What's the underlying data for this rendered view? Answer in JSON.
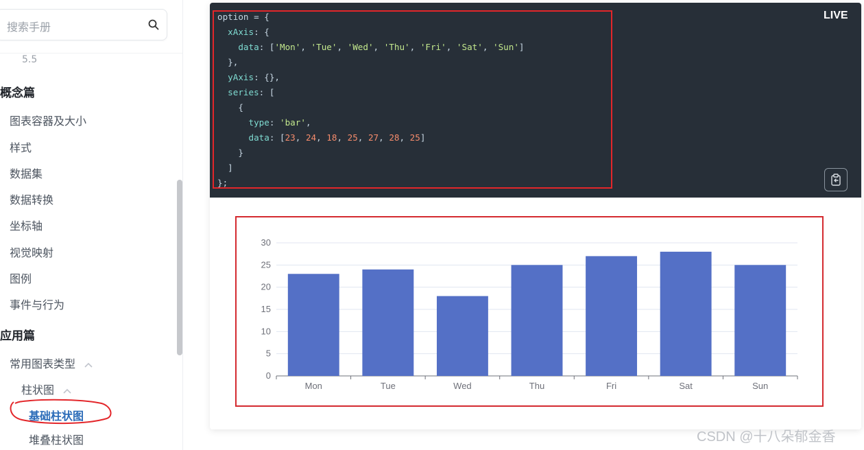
{
  "sidebar": {
    "search_placeholder": "搜索手册",
    "version_text": "5.5",
    "sections": {
      "concept": "概念篇",
      "application": "应用篇"
    },
    "concept_items": [
      "图表容器及大小",
      "样式",
      "数据集",
      "数据转换",
      "坐标轴",
      "视觉映射",
      "图例",
      "事件与行为"
    ],
    "application_items": {
      "common_types": "常用图表类型",
      "bar": "柱状图",
      "basic_bar": "基础柱状图",
      "stacked_bar": "堆叠柱状图"
    },
    "accent_color": "#2a6bb8"
  },
  "editor": {
    "live_label": "LIVE",
    "copy_icon": "clipboard-copy-icon",
    "code": {
      "l1": "option = {",
      "xaxis_key": "xAxis",
      "data_key": "data",
      "days": [
        "'Mon'",
        "'Tue'",
        "'Wed'",
        "'Thu'",
        "'Fri'",
        "'Sat'",
        "'Sun'"
      ],
      "yaxis_key": "yAxis",
      "series_key": "series",
      "type_key": "type",
      "type_value": "'bar'",
      "values": [
        "23",
        "24",
        "18",
        "25",
        "27",
        "28",
        "25"
      ]
    },
    "highlight_color": "#e3262a"
  },
  "chart_data": {
    "type": "bar",
    "categories": [
      "Mon",
      "Tue",
      "Wed",
      "Thu",
      "Fri",
      "Sat",
      "Sun"
    ],
    "values": [
      23,
      24,
      18,
      25,
      27,
      28,
      25
    ],
    "y_ticks": [
      0,
      5,
      10,
      15,
      20,
      25,
      30
    ],
    "ylim": [
      0,
      30
    ],
    "grid": true,
    "bar_color": "#5470c6"
  },
  "watermark": "CSDN @十八朵郁金香"
}
